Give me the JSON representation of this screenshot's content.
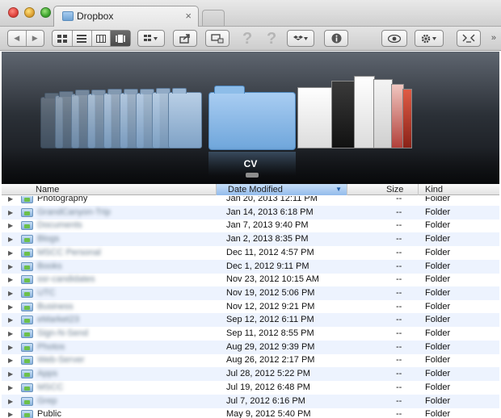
{
  "window": {
    "tab_title": "Dropbox",
    "tab_close": "×"
  },
  "toolbar": {
    "back_glyph": "◀",
    "forward_glyph": "▶",
    "help_marks": [
      "?",
      "?"
    ],
    "overflow": "»"
  },
  "coverflow": {
    "selected_label": "CV"
  },
  "columns": {
    "name": "Name",
    "date_modified": "Date Modified",
    "size": "Size",
    "kind": "Kind",
    "sort_arrow": "▼"
  },
  "rows": [
    {
      "name": "Photography",
      "date": "Jan 20, 2013 12:11 PM",
      "size": "--",
      "kind": "Folder",
      "blurred": false
    },
    {
      "name": "GrandCanyon-Trip",
      "date": "Jan 14, 2013 6:18 PM",
      "size": "--",
      "kind": "Folder",
      "blurred": true
    },
    {
      "name": "Documents",
      "date": "Jan 7, 2013 9:40 PM",
      "size": "--",
      "kind": "Folder",
      "blurred": true
    },
    {
      "name": "Blogs",
      "date": "Jan 2, 2013 8:35 PM",
      "size": "--",
      "kind": "Folder",
      "blurred": true
    },
    {
      "name": "MSCC Personal",
      "date": "Dec 11, 2012 4:57 PM",
      "size": "--",
      "kind": "Folder",
      "blurred": true
    },
    {
      "name": "Books",
      "date": "Dec 1, 2012 9:11 PM",
      "size": "--",
      "kind": "Folder",
      "blurred": true
    },
    {
      "name": "ssr-candidates",
      "date": "Nov 23, 2012 10:15 AM",
      "size": "--",
      "kind": "Folder",
      "blurred": true
    },
    {
      "name": "UTC",
      "date": "Nov 19, 2012 5:06 PM",
      "size": "--",
      "kind": "Folder",
      "blurred": true
    },
    {
      "name": "Business",
      "date": "Nov 12, 2012 9:21 PM",
      "size": "--",
      "kind": "Folder",
      "blurred": true
    },
    {
      "name": "eMarket23",
      "date": "Sep 12, 2012 6:11 PM",
      "size": "--",
      "kind": "Folder",
      "blurred": true
    },
    {
      "name": "Sign-N-Send",
      "date": "Sep 11, 2012 8:55 PM",
      "size": "--",
      "kind": "Folder",
      "blurred": true
    },
    {
      "name": "Photos",
      "date": "Aug 29, 2012 9:39 PM",
      "size": "--",
      "kind": "Folder",
      "blurred": true
    },
    {
      "name": "Web-Server",
      "date": "Aug 26, 2012 2:17 PM",
      "size": "--",
      "kind": "Folder",
      "blurred": true
    },
    {
      "name": "Apps",
      "date": "Jul 28, 2012 5:22 PM",
      "size": "--",
      "kind": "Folder",
      "blurred": true
    },
    {
      "name": "MSCC",
      "date": "Jul 19, 2012 6:48 PM",
      "size": "--",
      "kind": "Folder",
      "blurred": true
    },
    {
      "name": "Grep",
      "date": "Jul 7, 2012 6:16 PM",
      "size": "--",
      "kind": "Folder",
      "blurred": true
    },
    {
      "name": "Public",
      "date": "May 9, 2012 5:40 PM",
      "size": "--",
      "kind": "Folder",
      "blurred": false
    }
  ]
}
